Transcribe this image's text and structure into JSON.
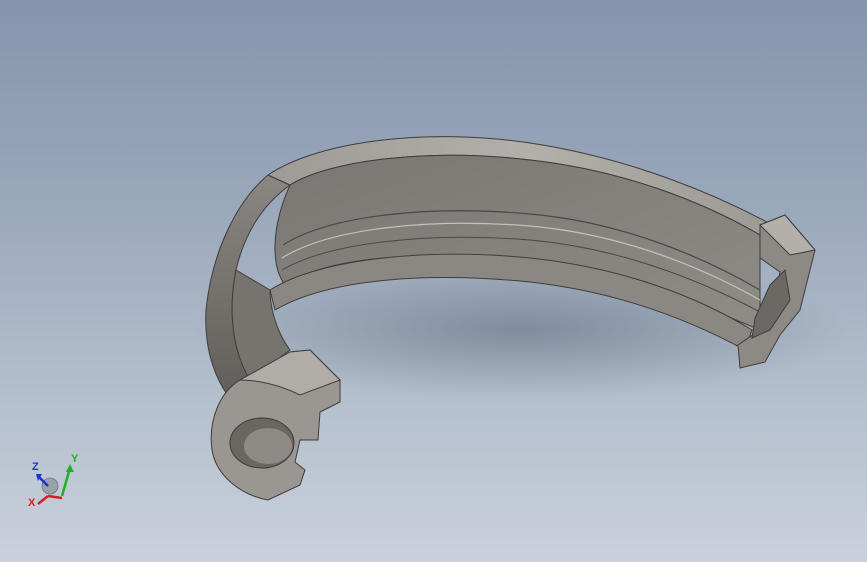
{
  "viewport": {
    "background_top": "#8495ad",
    "background_bottom": "#c9d1dc",
    "part_color": "#7d7a76",
    "part_highlight": "#a9a6a1",
    "part_shadow": "#5e5b57"
  },
  "triad": {
    "x_label": "X",
    "y_label": "Y",
    "z_label": "Z",
    "x_color": "#d42020",
    "y_color": "#20b020",
    "z_color": "#2030d0"
  }
}
